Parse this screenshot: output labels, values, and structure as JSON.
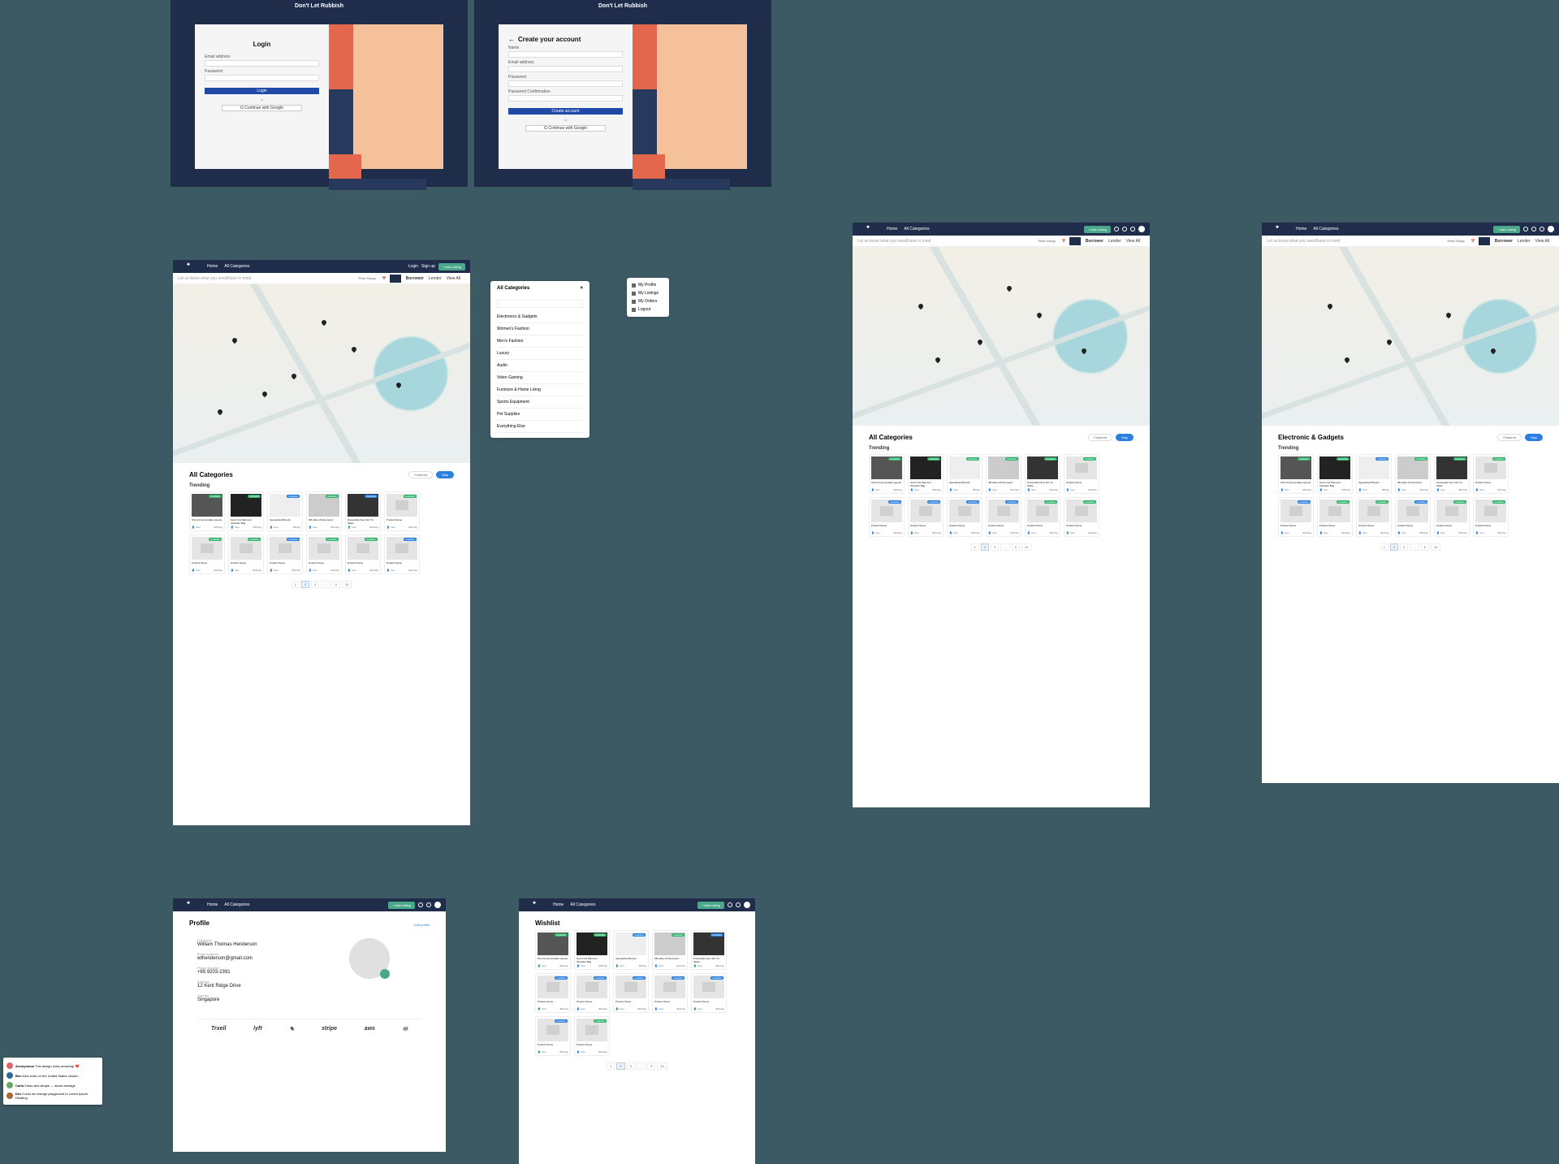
{
  "brand": "Don't Let Rubbish",
  "auth_login": {
    "title": "Login",
    "labels": {
      "email": "Email address",
      "password": "Password"
    },
    "primary": "Login",
    "divider": "or",
    "google": "Continue with Google"
  },
  "auth_signup": {
    "back": "←",
    "title": "Create your account",
    "labels": {
      "name": "Name",
      "email": "Email address",
      "password": "Password",
      "confirm": "Password Confirmation"
    },
    "primary": "Create account",
    "divider": "or",
    "google": "Continue with Google"
  },
  "header": {
    "nav": [
      "Home",
      "All Categories"
    ],
    "login": "Login",
    "signup": "Sign up",
    "add": "+ Add Listing"
  },
  "search": {
    "placeholder": "Let us know what you need/have in mind",
    "price_group": "Price Group",
    "date": "",
    "toggles": [
      "Borrower",
      "Lender",
      "View All"
    ]
  },
  "categories_panel": {
    "title": "All Categories",
    "close": "×",
    "items": [
      "Electronics & Gadgets",
      "Women's Fashion",
      "Men's Fashion",
      "Luxury",
      "Audio",
      "Video Gaming",
      "Furniture & Home Living",
      "Sports Equipment",
      "Pet Supplies",
      "Everything Else"
    ]
  },
  "user_menu": [
    "My Profile",
    "My Listings",
    "My Orders",
    "Logout"
  ],
  "listing": {
    "title_all": "All Categories",
    "title_electronics": "Electronic & Gadgets",
    "sub_trending": "Trending",
    "filter_featured": "Featured",
    "filter_map": "Map",
    "cards": [
      {
        "title": "Old old Cannondale speeds",
        "badge": "Available",
        "price": "$20/day",
        "thumb": "#555"
      },
      {
        "title": "Gucci GG Marmont Shoulder Bag",
        "badge": "Available",
        "price": "$45/day",
        "thumb": "#222"
      },
      {
        "title": "Specialized Bicycle",
        "badge": "Available",
        "price": "$8/day",
        "thumb": "#eee"
      },
      {
        "title": "SB white off-the-board",
        "badge": "Available",
        "price": "$12/day",
        "thumb": "#ccc"
      },
      {
        "title": "Powerslide Next 110 Tri-Skate",
        "badge": "Available",
        "price": "$10/day",
        "thumb": "#333"
      },
      {
        "title": "Product Name",
        "badge": "Available",
        "price": "$15/day",
        "thumb": ""
      },
      {
        "title": "Product Name",
        "badge": "Available",
        "price": "$15/day",
        "thumb": ""
      },
      {
        "title": "Product Name",
        "badge": "Available",
        "price": "$15/day",
        "thumb": ""
      },
      {
        "title": "Product Name",
        "badge": "Available",
        "price": "$15/day",
        "thumb": ""
      },
      {
        "title": "Product Name",
        "badge": "Available",
        "price": "$15/day",
        "thumb": ""
      },
      {
        "title": "Product Name",
        "badge": "Available",
        "price": "$15/day",
        "thumb": ""
      },
      {
        "title": "Product Name",
        "badge": "Available",
        "price": "$15/day",
        "thumb": ""
      }
    ],
    "pager": [
      "1",
      "2",
      "3",
      "...",
      "9",
      "10"
    ]
  },
  "profile": {
    "title": "Profile",
    "action": "Edit profile",
    "full_name_label": "Full Name",
    "full_name": "William Thomas Henderson",
    "email_label": "Email Address",
    "email": "wthenderson@gmail.com",
    "phone_label": "Phone Number",
    "phone": "+65 9203-2391",
    "address_label": "Address",
    "address": "12 Kent Ridge Drive",
    "country_label": "Country",
    "country": "Singapore",
    "logos": [
      "Trxell",
      "lyft",
      "✎",
      "stripe",
      "aws",
      "♾"
    ]
  },
  "wishlist": {
    "title": "Wishlist"
  },
  "comments": [
    {
      "user": "Anonymous",
      "text": "This design looks amazing! ❤️",
      "avatar": "#d66"
    },
    {
      "user": "Ben",
      "text": "Nice work on the United States version",
      "avatar": "#369"
    },
    {
      "user": "Carla",
      "text": "Clean and simple — about average",
      "avatar": "#6a6"
    },
    {
      "user": "Dev",
      "text": "Could we change playground to Lorem Ipsum Heading",
      "avatar": "#a63"
    }
  ]
}
